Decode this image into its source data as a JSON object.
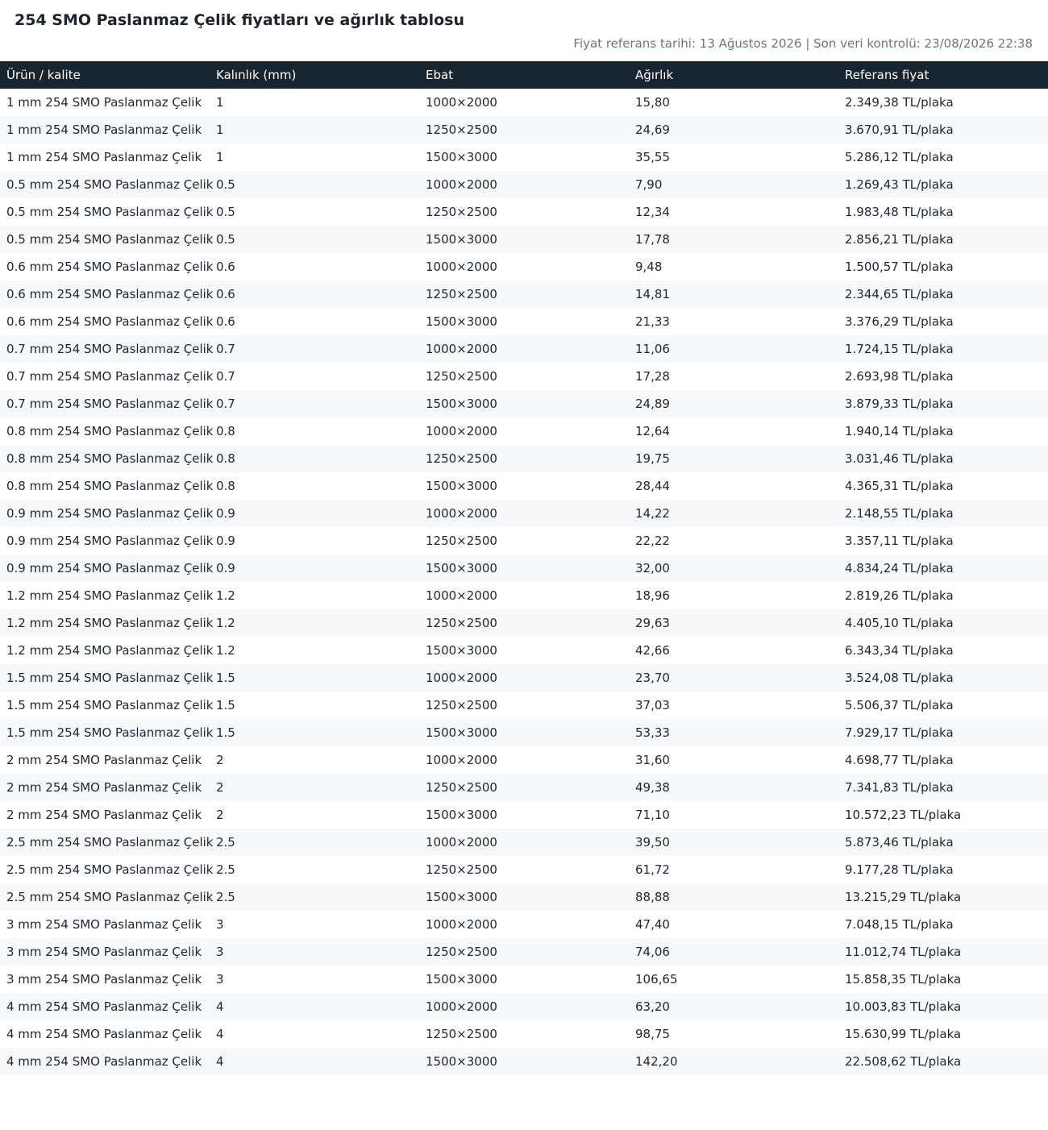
{
  "page": {
    "title": "254 SMO Paslanmaz Çelik fiyatları ve ağırlık tablosu",
    "meta": "Fiyat referans tarihi: 13 Ağustos 2026 | Son veri kontrolü: 23/08/2026 22:38"
  },
  "table": {
    "headers": [
      "Ürün / kalite",
      "Kalınlık (mm)",
      "Ebat",
      "Ağırlık",
      "Referans fiyat"
    ],
    "rows": [
      [
        "1 mm 254 SMO Paslanmaz Çelik",
        "1",
        "1000×2000",
        "15,80",
        "2.349,38 TL/plaka"
      ],
      [
        "1 mm 254 SMO Paslanmaz Çelik",
        "1",
        "1250×2500",
        "24,69",
        "3.670,91 TL/plaka"
      ],
      [
        "1 mm 254 SMO Paslanmaz Çelik",
        "1",
        "1500×3000",
        "35,55",
        "5.286,12 TL/plaka"
      ],
      [
        "0.5 mm 254 SMO Paslanmaz Çelik",
        "0.5",
        "1000×2000",
        "7,90",
        "1.269,43 TL/plaka"
      ],
      [
        "0.5 mm 254 SMO Paslanmaz Çelik",
        "0.5",
        "1250×2500",
        "12,34",
        "1.983,48 TL/plaka"
      ],
      [
        "0.5 mm 254 SMO Paslanmaz Çelik",
        "0.5",
        "1500×3000",
        "17,78",
        "2.856,21 TL/plaka"
      ],
      [
        "0.6 mm 254 SMO Paslanmaz Çelik",
        "0.6",
        "1000×2000",
        "9,48",
        "1.500,57 TL/plaka"
      ],
      [
        "0.6 mm 254 SMO Paslanmaz Çelik",
        "0.6",
        "1250×2500",
        "14,81",
        "2.344,65 TL/plaka"
      ],
      [
        "0.6 mm 254 SMO Paslanmaz Çelik",
        "0.6",
        "1500×3000",
        "21,33",
        "3.376,29 TL/plaka"
      ],
      [
        "0.7 mm 254 SMO Paslanmaz Çelik",
        "0.7",
        "1000×2000",
        "11,06",
        "1.724,15 TL/plaka"
      ],
      [
        "0.7 mm 254 SMO Paslanmaz Çelik",
        "0.7",
        "1250×2500",
        "17,28",
        "2.693,98 TL/plaka"
      ],
      [
        "0.7 mm 254 SMO Paslanmaz Çelik",
        "0.7",
        "1500×3000",
        "24,89",
        "3.879,33 TL/plaka"
      ],
      [
        "0.8 mm 254 SMO Paslanmaz Çelik",
        "0.8",
        "1000×2000",
        "12,64",
        "1.940,14 TL/plaka"
      ],
      [
        "0.8 mm 254 SMO Paslanmaz Çelik",
        "0.8",
        "1250×2500",
        "19,75",
        "3.031,46 TL/plaka"
      ],
      [
        "0.8 mm 254 SMO Paslanmaz Çelik",
        "0.8",
        "1500×3000",
        "28,44",
        "4.365,31 TL/plaka"
      ],
      [
        "0.9 mm 254 SMO Paslanmaz Çelik",
        "0.9",
        "1000×2000",
        "14,22",
        "2.148,55 TL/plaka"
      ],
      [
        "0.9 mm 254 SMO Paslanmaz Çelik",
        "0.9",
        "1250×2500",
        "22,22",
        "3.357,11 TL/plaka"
      ],
      [
        "0.9 mm 254 SMO Paslanmaz Çelik",
        "0.9",
        "1500×3000",
        "32,00",
        "4.834,24 TL/plaka"
      ],
      [
        "1.2 mm 254 SMO Paslanmaz Çelik",
        "1.2",
        "1000×2000",
        "18,96",
        "2.819,26 TL/plaka"
      ],
      [
        "1.2 mm 254 SMO Paslanmaz Çelik",
        "1.2",
        "1250×2500",
        "29,63",
        "4.405,10 TL/plaka"
      ],
      [
        "1.2 mm 254 SMO Paslanmaz Çelik",
        "1.2",
        "1500×3000",
        "42,66",
        "6.343,34 TL/plaka"
      ],
      [
        "1.5 mm 254 SMO Paslanmaz Çelik",
        "1.5",
        "1000×2000",
        "23,70",
        "3.524,08 TL/plaka"
      ],
      [
        "1.5 mm 254 SMO Paslanmaz Çelik",
        "1.5",
        "1250×2500",
        "37,03",
        "5.506,37 TL/plaka"
      ],
      [
        "1.5 mm 254 SMO Paslanmaz Çelik",
        "1.5",
        "1500×3000",
        "53,33",
        "7.929,17 TL/plaka"
      ],
      [
        "2 mm 254 SMO Paslanmaz Çelik",
        "2",
        "1000×2000",
        "31,60",
        "4.698,77 TL/plaka"
      ],
      [
        "2 mm 254 SMO Paslanmaz Çelik",
        "2",
        "1250×2500",
        "49,38",
        "7.341,83 TL/plaka"
      ],
      [
        "2 mm 254 SMO Paslanmaz Çelik",
        "2",
        "1500×3000",
        "71,10",
        "10.572,23 TL/plaka"
      ],
      [
        "2.5 mm 254 SMO Paslanmaz Çelik",
        "2.5",
        "1000×2000",
        "39,50",
        "5.873,46 TL/plaka"
      ],
      [
        "2.5 mm 254 SMO Paslanmaz Çelik",
        "2.5",
        "1250×2500",
        "61,72",
        "9.177,28 TL/plaka"
      ],
      [
        "2.5 mm 254 SMO Paslanmaz Çelik",
        "2.5",
        "1500×3000",
        "88,88",
        "13.215,29 TL/plaka"
      ],
      [
        "3 mm 254 SMO Paslanmaz Çelik",
        "3",
        "1000×2000",
        "47,40",
        "7.048,15 TL/plaka"
      ],
      [
        "3 mm 254 SMO Paslanmaz Çelik",
        "3",
        "1250×2500",
        "74,06",
        "11.012,74 TL/plaka"
      ],
      [
        "3 mm 254 SMO Paslanmaz Çelik",
        "3",
        "1500×3000",
        "106,65",
        "15.858,35 TL/plaka"
      ],
      [
        "4 mm 254 SMO Paslanmaz Çelik",
        "4",
        "1000×2000",
        "63,20",
        "10.003,83 TL/plaka"
      ],
      [
        "4 mm 254 SMO Paslanmaz Çelik",
        "4",
        "1250×2500",
        "98,75",
        "15.630,99 TL/plaka"
      ],
      [
        "4 mm 254 SMO Paslanmaz Çelik",
        "4",
        "1500×3000",
        "142,20",
        "22.508,62 TL/plaka"
      ]
    ]
  }
}
